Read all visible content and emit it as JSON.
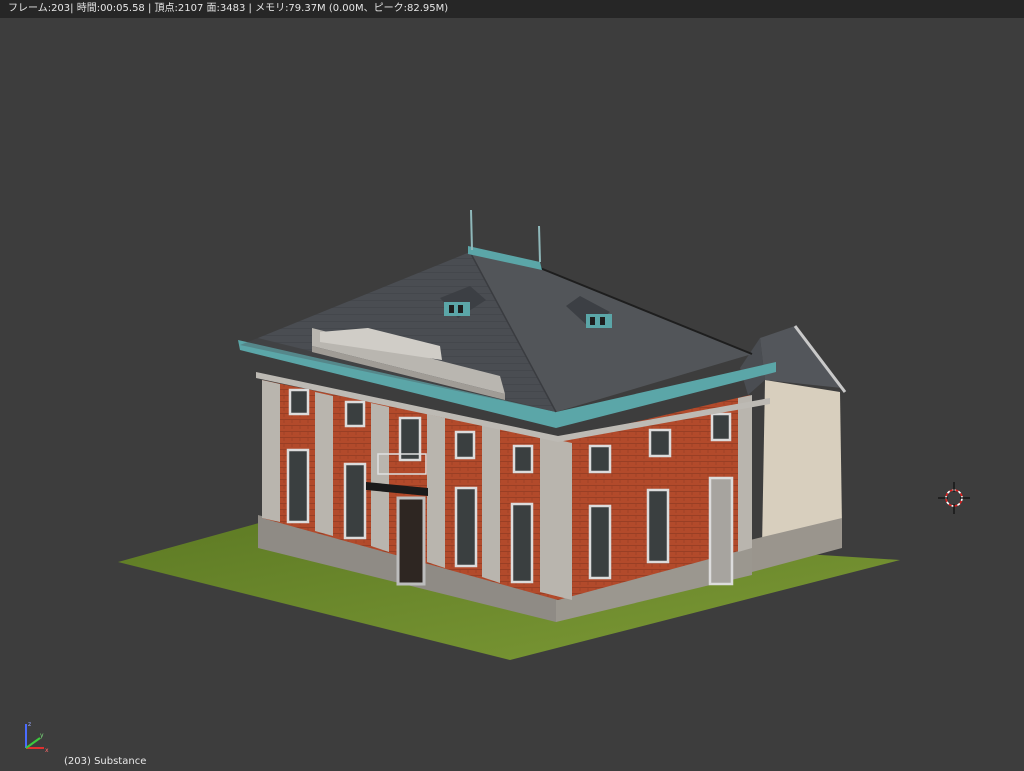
{
  "status_bar": {
    "text": "フレーム:203| 時間:00:05.58 | 頂点:2107 面:3483 | メモリ:79.37M (0.00M、ピーク:82.95M)"
  },
  "viewport": {
    "object_label": "(203) Substance",
    "background_color": "#3d3d3d"
  },
  "icons": {
    "axis_gizmo": "axis-gizmo-icon",
    "cursor_3d": "3d-cursor-icon"
  },
  "colors": {
    "brick": "#b34a2c",
    "stone": "#a8a49e",
    "roof": "#4a4d52",
    "trim_teal": "#5aa7a8",
    "ground": "#6f8a2e"
  }
}
